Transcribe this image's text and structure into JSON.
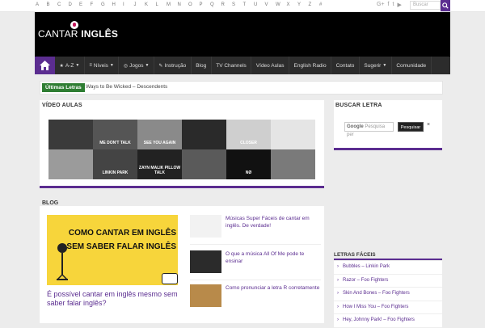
{
  "alphabet": [
    "A",
    "B",
    "C",
    "D",
    "E",
    "F",
    "G",
    "H",
    "I",
    "J",
    "K",
    "L",
    "M",
    "N",
    "O",
    "P",
    "Q",
    "R",
    "S",
    "T",
    "U",
    "V",
    "W",
    "X",
    "Y",
    "Z",
    "#"
  ],
  "social": [
    "G+",
    "f",
    "t",
    "▶"
  ],
  "top_search": {
    "placeholder": "Buscar"
  },
  "logo": {
    "part1": "CANTAR ",
    "part2": "INGLÊS"
  },
  "nav": [
    {
      "label": "A-Z",
      "icon": "star-icon",
      "caret": true
    },
    {
      "label": "Níveis",
      "icon": "bars-icon",
      "caret": true
    },
    {
      "label": "Jogos",
      "icon": "gamepad-icon",
      "caret": true
    },
    {
      "label": "Instrução",
      "icon": "pencil-icon",
      "caret": false
    },
    {
      "label": "Blog",
      "icon": "",
      "caret": false
    },
    {
      "label": "TV Channels",
      "icon": "",
      "caret": false
    },
    {
      "label": "Vídeo Aulas",
      "icon": "",
      "caret": false
    },
    {
      "label": "English Radio",
      "icon": "",
      "caret": false
    },
    {
      "label": "Contato",
      "icon": "",
      "caret": false
    },
    {
      "label": "Sugerir",
      "icon": "",
      "caret": true
    },
    {
      "label": "Comunidade",
      "icon": "",
      "caret": false
    }
  ],
  "ticker": {
    "label": "Últimas Letras",
    "text": "Ways to Be Wicked – Descendents"
  },
  "video": {
    "title": "VÍDEO AULAS",
    "thumbs": [
      {
        "bg": "#3a3a3a",
        "caption": ""
      },
      {
        "bg": "#555",
        "caption": "ME DON'T TALK"
      },
      {
        "bg": "#8a8a8a",
        "caption": "SEE YOU AGAIN"
      },
      {
        "bg": "#2a2a2a",
        "caption": ""
      },
      {
        "bg": "#cfcfcf",
        "caption": "CLOSER"
      },
      {
        "bg": "#e5e5e5",
        "caption": ""
      },
      {
        "bg": "#9b9b9b",
        "caption": ""
      },
      {
        "bg": "#444",
        "caption": "LINKIN PARK"
      },
      {
        "bg": "#222",
        "caption": "ZAYN MALIK PILLOW TALK"
      },
      {
        "bg": "#5a5a5a",
        "caption": ""
      },
      {
        "bg": "#111",
        "caption": "NØ"
      },
      {
        "bg": "#7a7a7a",
        "caption": ""
      }
    ]
  },
  "blog": {
    "title": "BLOG",
    "featured_image_text": "COMO CANTAR EM INGLÊS SEM SABER FALAR INGLÊS",
    "featured_title": "É possível cantar em inglês mesmo sem saber falar inglês?",
    "posts": [
      {
        "title": "Músicas Super Fáceis de cantar em inglês. De verdade!",
        "thumb": "#f2f2f2"
      },
      {
        "title": "O que a música All Of Me pode te ensinar",
        "thumb": "#2b2b2b"
      },
      {
        "title": "Como pronunciar a letra R corretamente",
        "thumb": "#b88a4a"
      }
    ]
  },
  "buscar": {
    "title": "BUSCAR LETRA",
    "google": "Google",
    "placeholder": "Pesquisa per",
    "button": "Pesquisar",
    "close": "×"
  },
  "letras": {
    "title": "LETRAS FÁCEIS",
    "items": [
      "Bubbles – Linkin Park",
      "Razor – Foo Fighters",
      "Skin And Bones – Foo Fighters",
      "How I Miss You – Foo Fighters",
      "Hey, Johnny Park! – Foo Fighters"
    ]
  },
  "colors": {
    "accent": "#5b2d90",
    "ticker": "#2e7d32",
    "header": "#000000",
    "nav": "#2c2c2c"
  }
}
